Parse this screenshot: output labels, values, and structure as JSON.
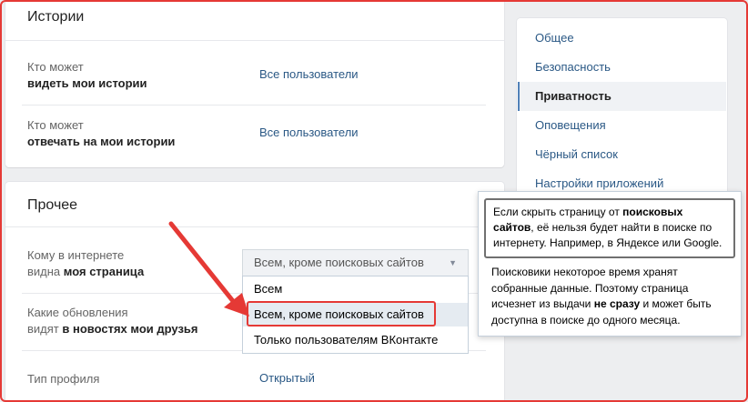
{
  "stories": {
    "title": "Истории",
    "rows": [
      {
        "label_prefix": "Кто может",
        "label_bold": "видеть мои истории",
        "value": "Все пользователи"
      },
      {
        "label_prefix": "Кто может",
        "label_bold": "отвечать на мои истории",
        "value": "Все пользователи"
      }
    ]
  },
  "other": {
    "title": "Прочее",
    "row1": {
      "label_line1": "Кому в интернете",
      "label_line2_plain": "видна ",
      "label_line2_bold": "моя страница"
    },
    "row2": {
      "label_line1_plain": "Какие обновления",
      "label_line2_plain": "видят ",
      "label_line2_bold": "в новостях мои друзья"
    },
    "row3": {
      "label": "Тип профиля",
      "value": "Открытый"
    }
  },
  "dropdown": {
    "selected": "Всем, кроме поисковых сайтов",
    "options": [
      "Всем",
      "Всем, кроме поисковых сайтов",
      "Только пользователям ВКонтакте"
    ]
  },
  "menu": {
    "items": [
      "Общее",
      "Безопасность",
      "Приватность",
      "Оповещения",
      "Чёрный список",
      "Настройки приложений"
    ]
  },
  "tooltip": {
    "hl_pre": "Если скрыть страницу от ",
    "hl_bold": "поисковых сайтов",
    "hl_post": ", её нельзя будет найти в поиске по интернету. Например, в Яндексе или Google.",
    "body_pre": "Поисковики некоторое время хранят собранные данные. Поэтому страница исчезнет из выдачи ",
    "body_bold": "не сразу",
    "body_post": " и может быть доступна в поиске до одного месяца."
  },
  "colors": {
    "accent": "#5181b8",
    "link": "#2a5885",
    "highlight_border": "#e53935"
  }
}
